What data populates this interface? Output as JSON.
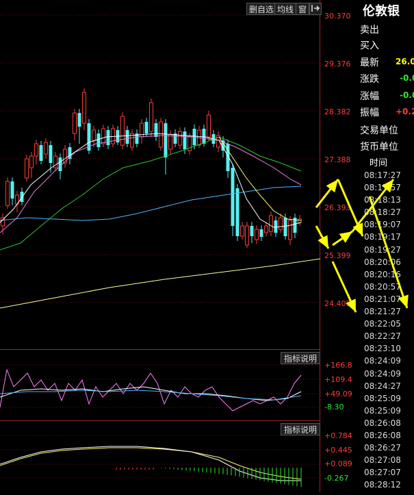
{
  "toolbar": {
    "remove_watch_label": "删自选",
    "ma_label": "均线",
    "window_label": "窗",
    "exit_icon": "exit-arrow-icon"
  },
  "price_axis": [
    "30.370",
    "29.376",
    "28.382",
    "27.388",
    "26.393",
    "25.399",
    "24.405"
  ],
  "indicator1": {
    "button_label": "指标说明",
    "axis": [
      "+166.8",
      "+109.4",
      "+49.09",
      "-8.30"
    ]
  },
  "indicator2": {
    "button_label": "指标说明",
    "axis": [
      "+0.784",
      "+0.445",
      "+0.089",
      "-0.267"
    ]
  },
  "quote_panel": {
    "title": "伦敦银",
    "sell_label": "卖出",
    "buy_label": "买入",
    "latest_label": "最新",
    "latest_value": "26.0",
    "change_label": "涨跌",
    "change_value": "-0.0",
    "change_pct_label": "涨幅",
    "change_pct_value": "-0.0",
    "amplitude_label": "振幅",
    "amplitude_value": "+0.2",
    "trade_unit_label": "交易单位",
    "currency_unit_label": "货币单位",
    "time_header": "时间",
    "times": [
      "08:17:27",
      "08:17:57",
      "08:18:13",
      "08:18:27",
      "08:19:07",
      "08:19:17",
      "08:19:27",
      "08:20:06",
      "08:20:16",
      "08:20:57",
      "08:21:07",
      "08:21:27",
      "08:22:05",
      "08:22:27",
      "08:23:10",
      "08:24:09",
      "08:24:09",
      "08:24:27",
      "08:25:09",
      "08:25:09",
      "08:26:08",
      "08:26:08",
      "08:26:27",
      "08:27:08",
      "08:27:07",
      "08:28:12"
    ]
  },
  "colors": {
    "up": "#ff3b3b",
    "down": "#54f0f0",
    "axis": "#ff3b3b",
    "annotation_arrow": "#ffff00"
  }
}
